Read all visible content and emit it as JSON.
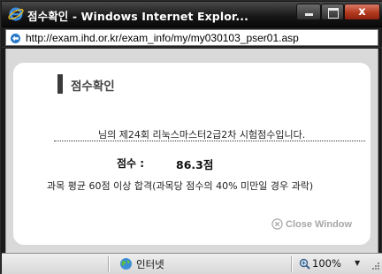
{
  "window": {
    "title": "점수확인 - Windows Internet Explor...",
    "close_symbol": "x"
  },
  "address_bar": {
    "url": "http://exam.ihd.or.kr/exam_info/my/my030103_pser01.asp"
  },
  "page": {
    "heading": "점수확인",
    "result_line": "님의 제24회 리눅스마스터2급2차 시험점수입니다.",
    "score_label": "점수 :",
    "score_value": "86.3점",
    "pass_note": "과목 평균 60점 이상 합격(과목당 점수의 40% 미만일 경우 과락)",
    "close_window_label": "Close Window"
  },
  "status_bar": {
    "zone": "인터넷",
    "zoom": "100%"
  },
  "icons": {
    "browser": "ie-logo-icon",
    "page": "page-icon",
    "close": "close-circle-icon",
    "zone": "globe-icon",
    "zoom": "zoom-magnifier-icon"
  },
  "colors": {
    "titlebar": "#161616",
    "close_button": "#b33a1e",
    "page_background": "#d9d9d9",
    "card": "#ffffff",
    "close_link": "#a7a7a7"
  }
}
